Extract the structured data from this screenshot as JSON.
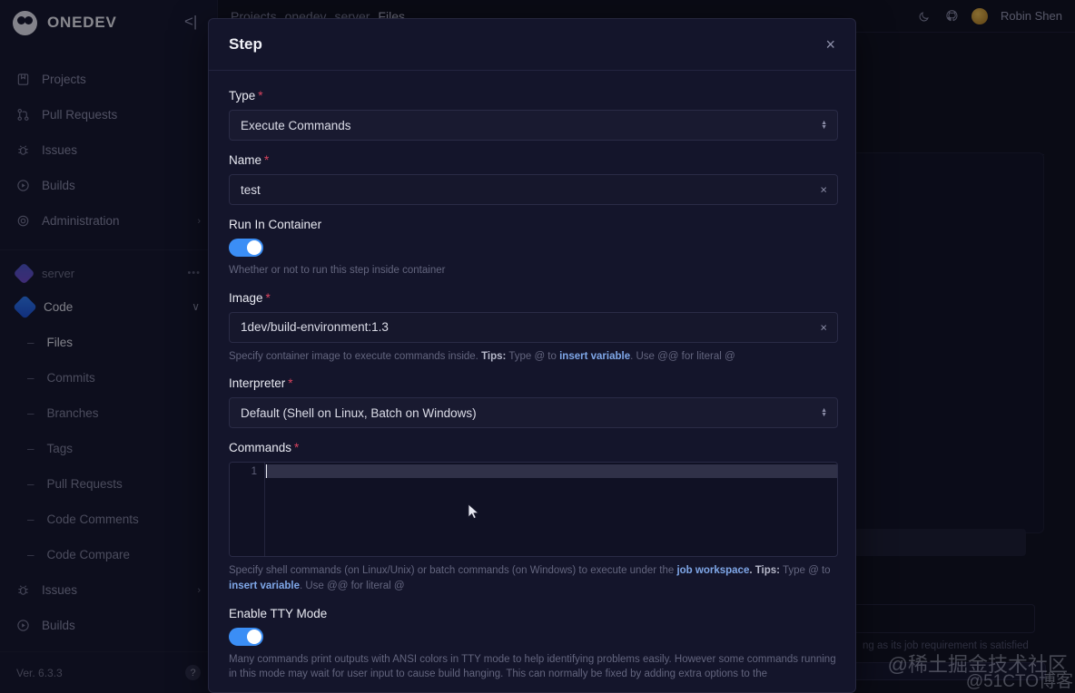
{
  "app": {
    "brand": "ONEDEV",
    "version": "Ver. 6.3.3",
    "collapse_icon": "<|",
    "help_icon": "?"
  },
  "sidebar": {
    "items": [
      {
        "label": "Projects",
        "icon": "projects-icon",
        "chevron": ""
      },
      {
        "label": "Pull Requests",
        "icon": "pull-request-icon",
        "chevron": ""
      },
      {
        "label": "Issues",
        "icon": "bug-icon",
        "chevron": ""
      },
      {
        "label": "Builds",
        "icon": "play-circle-icon",
        "chevron": ""
      },
      {
        "label": "Administration",
        "icon": "gear-icon",
        "chevron": "›"
      }
    ],
    "context": {
      "project": "server",
      "project_dots": "•••",
      "code_label": "Code",
      "code_chevron": "∨"
    },
    "sub_items": [
      {
        "label": "Files",
        "active": true,
        "chevron": ""
      },
      {
        "label": "Commits",
        "active": false,
        "chevron": ""
      },
      {
        "label": "Branches",
        "active": false,
        "chevron": ""
      },
      {
        "label": "Tags",
        "active": false,
        "chevron": ""
      },
      {
        "label": "Pull Requests",
        "active": false,
        "chevron": ""
      },
      {
        "label": "Code Comments",
        "active": false,
        "chevron": ""
      },
      {
        "label": "Code Compare",
        "active": false,
        "chevron": ""
      }
    ],
    "bottom_items": [
      {
        "label": "Issues",
        "icon": "bug-icon",
        "chevron": "›"
      },
      {
        "label": "Builds",
        "icon": "play-circle-icon",
        "chevron": ""
      }
    ]
  },
  "topbar": {
    "breadcrumbs": [
      "Projects",
      "onedev",
      "server",
      "Files"
    ],
    "separator": "/",
    "user_name": "Robin Shen",
    "theme_icon": "moon-icon",
    "github_icon": "github-icon"
  },
  "modal": {
    "title": "Step",
    "close_icon": "×",
    "fields": {
      "type": {
        "label": "Type",
        "required": "*",
        "value": "Execute Commands"
      },
      "name": {
        "label": "Name",
        "required": "*",
        "value": "test",
        "clear_icon": "×"
      },
      "run_in_container": {
        "label": "Run In Container",
        "enabled": true,
        "help": "Whether or not to run this step inside container"
      },
      "image": {
        "label": "Image",
        "required": "*",
        "value": "1dev/build-environment:1.3",
        "clear_icon": "×",
        "help_prefix": "Specify container image to execute commands inside. ",
        "help_tips": "Tips:",
        "help_mid": " Type @ to ",
        "help_link": "insert variable",
        "help_suffix": ". Use @@ for literal @"
      },
      "interpreter": {
        "label": "Interpreter",
        "required": "*",
        "value": "Default (Shell on Linux, Batch on Windows)"
      },
      "commands": {
        "label": "Commands",
        "required": "*",
        "line_number": "1",
        "value": "",
        "help_prefix": "Specify shell commands (on Linux/Unix) or batch commands (on Windows) to execute under the ",
        "help_link1": "job workspace",
        "help_tips": ". Tips:",
        "help_mid": " Type @ to ",
        "help_link2": "insert variable",
        "help_suffix": ". Use @@ for literal @"
      },
      "tty_mode": {
        "label": "Enable TTY Mode",
        "enabled": true,
        "help": "Many commands print outputs with ANSI colors in TTY mode to help identifying problems easily. However some commands running in this mode may wait for user input to cause build hanging. This can normally be fixed by adding extra options to the"
      }
    }
  },
  "background": {
    "note": "ng as its job requirement is satisfied",
    "row_menu_icon": "•••",
    "row_delete_icon": "trash-icon",
    "search_clear_icon": "×",
    "rows": [
      {
        "id": "row-1"
      },
      {
        "id": "row-2"
      },
      {
        "id": "row-3"
      },
      {
        "id": "row-4"
      }
    ]
  },
  "watermark": {
    "line1": "@稀土掘金技术社区",
    "line2": "@51CTO博客"
  },
  "colors": {
    "accent": "#3b8ef5",
    "required": "#d9435e",
    "bg": "#0e0f1c",
    "panel": "#14152b",
    "link": "#7fa7e8"
  }
}
